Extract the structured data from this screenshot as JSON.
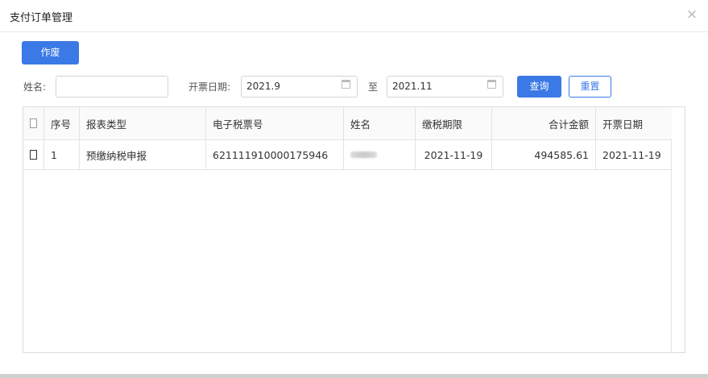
{
  "dialog": {
    "title": "支付订单管理",
    "close_icon": "×"
  },
  "toolbar": {
    "void_label": "作废"
  },
  "filters": {
    "name_label": "姓名:",
    "name_value": "",
    "date_label": "开票日期:",
    "date_from": "2021.9",
    "to_label": "至",
    "date_to": "2021.11",
    "search_label": "查询",
    "reset_label": "重置"
  },
  "table": {
    "headers": [
      "序号",
      "报表类型",
      "电子税票号",
      "姓名",
      "缴税期限",
      "合计金额",
      "开票日期"
    ],
    "rows": [
      {
        "index": "1",
        "type": "预缴纳税申报",
        "ticket_no": "621111910000175946",
        "name": "",
        "deadline": "2021-11-19",
        "amount": "494585.61",
        "issue_date": "2021-11-19"
      }
    ]
  },
  "colors": {
    "primary": "#3a79e6",
    "border": "#e3e3e3"
  }
}
